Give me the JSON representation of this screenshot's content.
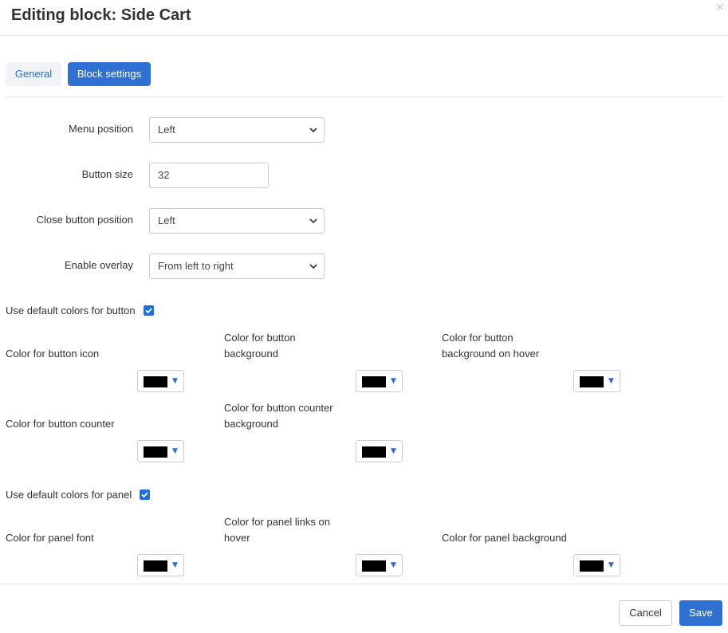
{
  "dialog": {
    "title": "Editing block: Side Cart",
    "close_glyph": "×"
  },
  "tabs": [
    {
      "label": "General",
      "active": false
    },
    {
      "label": "Block settings",
      "active": true
    }
  ],
  "fields": {
    "menu_position": {
      "label": "Menu position",
      "value": "Left"
    },
    "button_size": {
      "label": "Button size",
      "value": "32"
    },
    "close_button_position": {
      "label": "Close button position",
      "value": "Left"
    },
    "enable_overlay": {
      "label": "Enable overlay",
      "value": "From left to right"
    }
  },
  "button_colors": {
    "use_default_label": "Use default colors for button",
    "use_default_checked": true,
    "icon": {
      "label": "Color for button icon",
      "color": "#000000"
    },
    "background": {
      "label": "Color for button background",
      "color": "#000000"
    },
    "background_hover": {
      "label": "Color for button background on hover",
      "color": "#000000"
    },
    "counter": {
      "label": "Color for button counter",
      "color": "#000000"
    },
    "counter_background": {
      "label": "Color for button counter background",
      "color": "#000000"
    }
  },
  "panel_colors": {
    "use_default_label": "Use default colors for panel",
    "use_default_checked": true,
    "font": {
      "label": "Color for panel font",
      "color": "#000000"
    },
    "links_hover": {
      "label": "Color for panel links on hover",
      "color": "#000000"
    },
    "background": {
      "label": "Color for panel background",
      "color": "#000000"
    }
  },
  "picker_arrow": "▼",
  "footer": {
    "cancel_label": "Cancel",
    "save_label": "Save"
  },
  "theme": {
    "primary": "#2f70d3",
    "checkbox": "#1e6fd9",
    "link": "#2a6ecb"
  }
}
